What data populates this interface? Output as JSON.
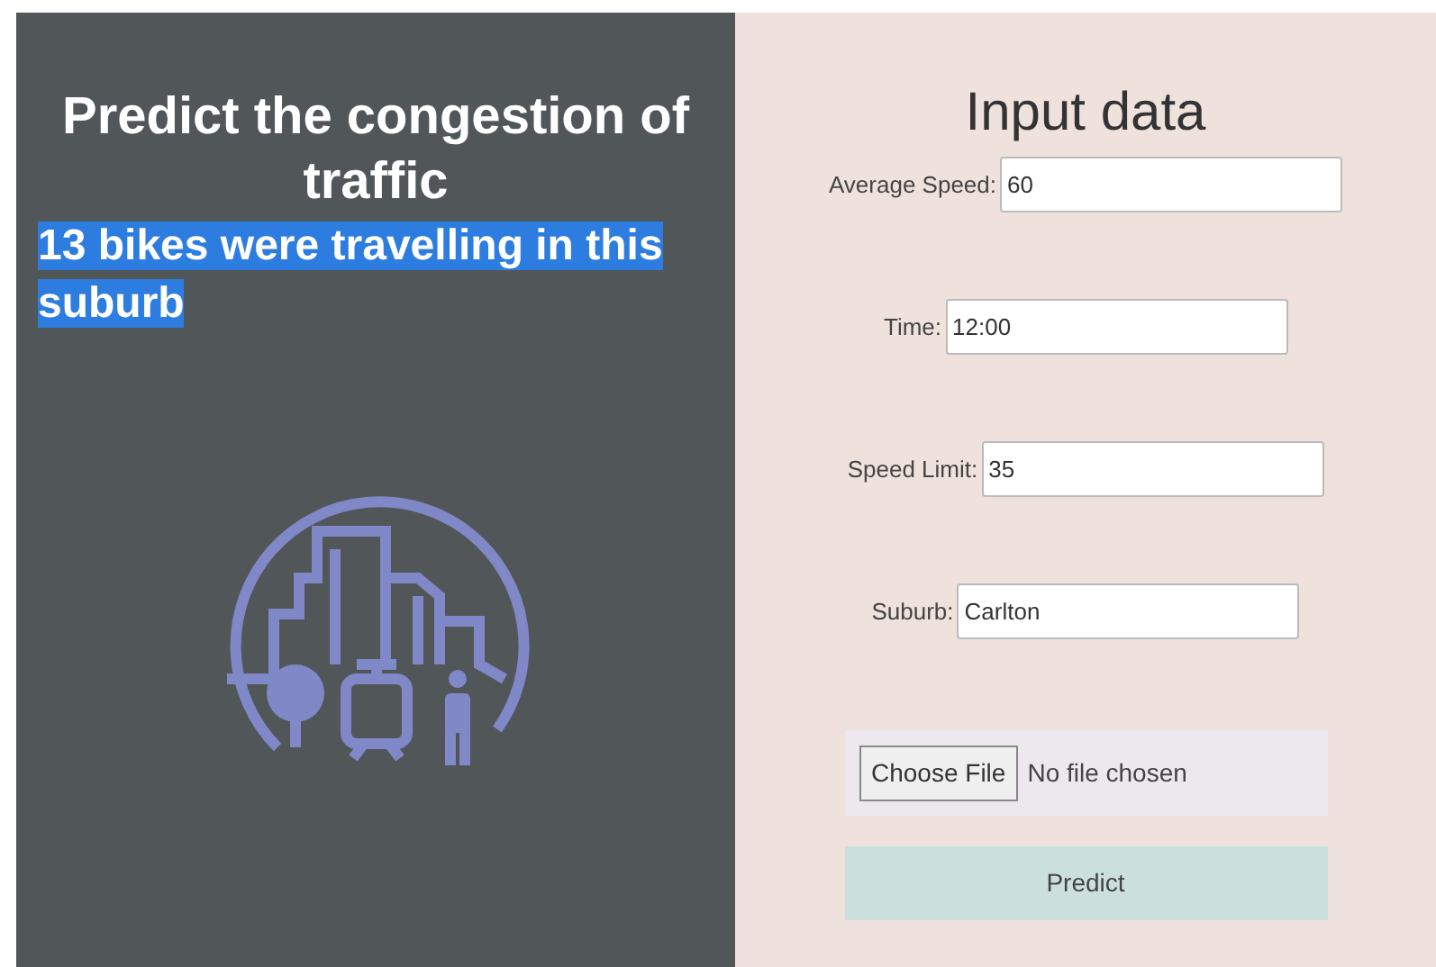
{
  "left_panel": {
    "title": "Predict the congestion of traffic",
    "result": {
      "text": "13 bikes were travelling in this suburb",
      "highlighted": true
    }
  },
  "form": {
    "title": "Input data",
    "fields": [
      {
        "label": "Average Speed:",
        "value": "60"
      },
      {
        "label": "Time:",
        "value": "12:00"
      },
      {
        "label": "Speed Limit:",
        "value": "35"
      },
      {
        "label": "Suburb:",
        "value": "Carlton"
      }
    ],
    "file_input": {
      "button": "Choose File",
      "status": "No file chosen"
    },
    "submit": "Predict"
  }
}
